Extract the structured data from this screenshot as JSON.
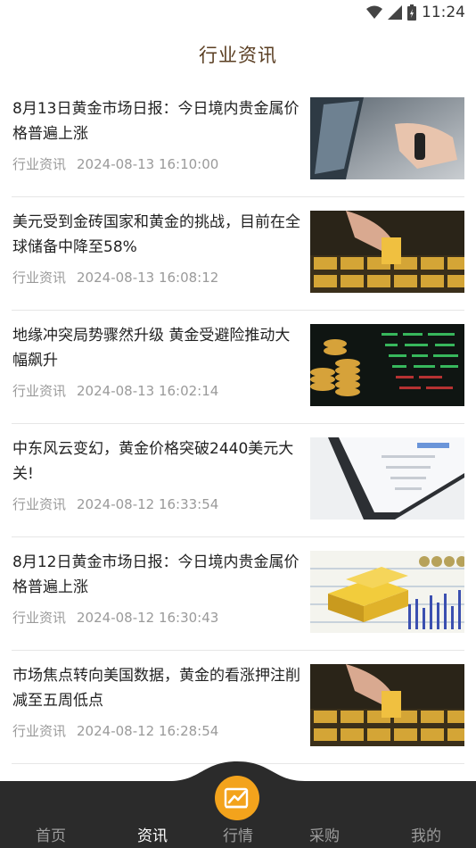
{
  "status_bar": {
    "time": "11:24"
  },
  "header": {
    "title": "行业资讯"
  },
  "news": [
    {
      "title": "8月13日黄金市场日报：今日境内贵金属价格普遍上涨",
      "category": "行业资讯",
      "time": "2024-08-13 16:10:00"
    },
    {
      "title": "美元受到金砖国家和黄金的挑战，目前在全球储备中降至58%",
      "category": "行业资讯",
      "time": "2024-08-13 16:08:12"
    },
    {
      "title": "地缘冲突局势骤然升级 黄金受避险推动大幅飙升",
      "category": "行业资讯",
      "time": "2024-08-13 16:02:14"
    },
    {
      "title": "中东风云变幻，黄金价格突破2440美元大关!",
      "category": "行业资讯",
      "time": "2024-08-12 16:33:54"
    },
    {
      "title": "8月12日黄金市场日报：今日境内贵金属价格普遍上涨",
      "category": "行业资讯",
      "time": "2024-08-12 16:30:43"
    },
    {
      "title": "市场焦点转向美国数据，黄金的看涨押注削减至五周低点",
      "category": "行业资讯",
      "time": "2024-08-12 16:28:54"
    }
  ],
  "tabbar": {
    "home": "首页",
    "news": "资讯",
    "market": "行情",
    "purchase": "采购",
    "mine": "我的"
  },
  "colors": {
    "accent": "#f3a31c",
    "tabbar_bg": "#2b2b2b",
    "title_brown": "#5a3e22"
  }
}
